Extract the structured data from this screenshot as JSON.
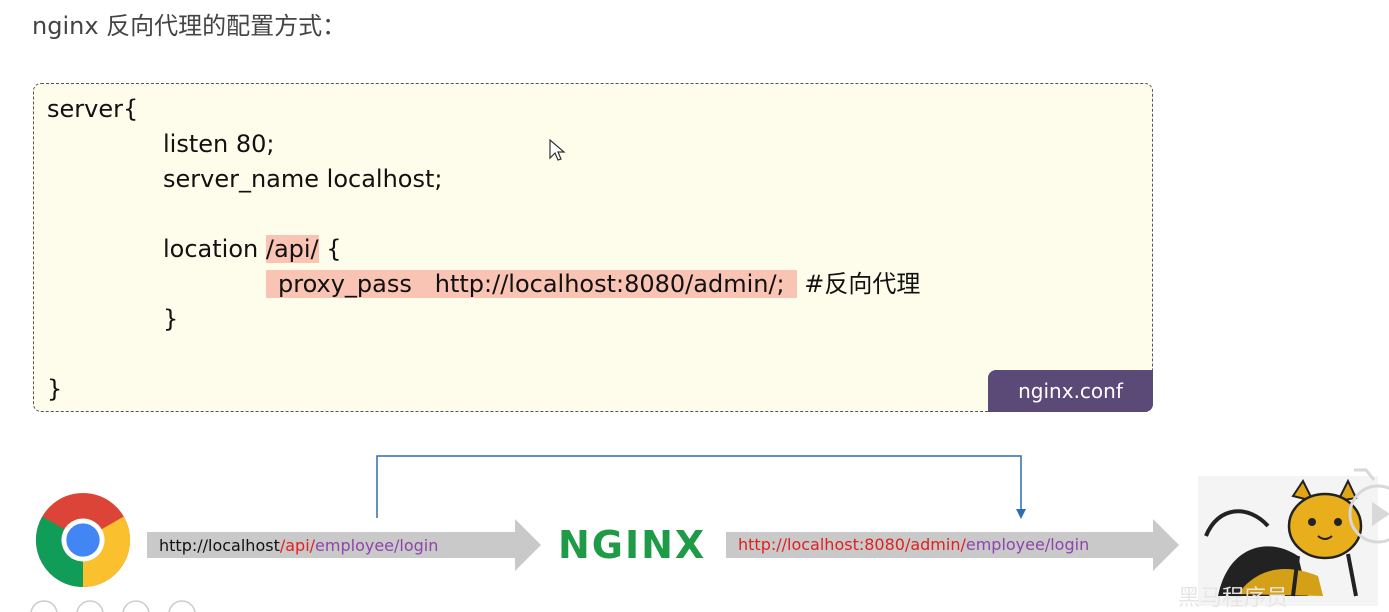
{
  "heading": "nginx 反向代理的配置方式：",
  "config": {
    "line1": "server{",
    "line2": "listen 80;",
    "line3": "server_name localhost;",
    "line4_prefix": "location ",
    "line4_hl": "/api/",
    "line4_suffix": " {",
    "line5_hl": "proxy_pass   http://localhost:8080/admin/;",
    "line5_comment": " #反向代理",
    "line6": "}",
    "line7": "}",
    "file_tag": "nginx.conf"
  },
  "flow": {
    "request_url": {
      "host": "http://localhost",
      "api": "/api/",
      "path": "employee/login"
    },
    "proxy_name": "NGINX",
    "forward_url": {
      "host": "http://localhost:8080/admin/",
      "path": "employee/login"
    }
  },
  "colors": {
    "highlight": "#f9c4b3",
    "tag_bg": "#5b4a78",
    "api_red": "#e02020",
    "path_purple": "#8e44ad",
    "nginx_green": "#1f9a46",
    "line_blue": "#2e6db4",
    "code_bg": "#fefdeb"
  },
  "icons": {
    "browser": "chrome-icon",
    "server": "tomcat-icon",
    "cursor": "mouse-cursor-icon"
  },
  "watermark": "黑马程序员"
}
